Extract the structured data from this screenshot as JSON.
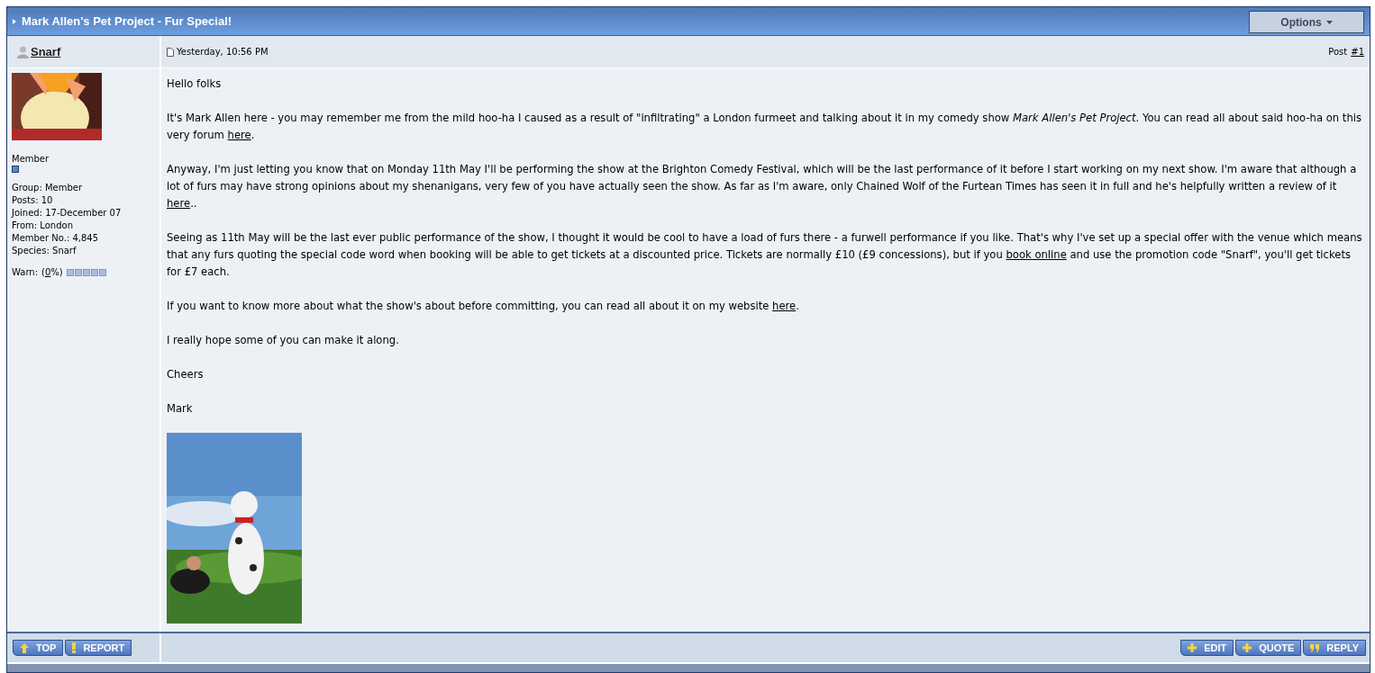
{
  "title": "Mark Allen's Pet Project - Fur Special!",
  "options_button": "Options",
  "author": {
    "name": "Snarf"
  },
  "post_meta": {
    "date": "Yesterday, 10:56 PM",
    "label": "Post",
    "number": "#1"
  },
  "sidebar": {
    "avatar": {
      "kind": "picture"
    },
    "rank": "Member",
    "details": [
      "Group: Member",
      "Posts: 10",
      "Joined: 17-December 07",
      "From: London",
      "Member No.: 4,845",
      "Species: Snarf"
    ],
    "warn": {
      "label": "Warn:",
      "open": "(",
      "link": "0",
      "close": "%)"
    }
  },
  "paragraphs": [
    [
      {
        "kind": "text",
        "text": "Hello folks"
      }
    ],
    [
      {
        "kind": "text",
        "text": "It's Mark Allen here - you may remember me from the mild hoo-ha I caused as a result of \"infiltrating\" a London furmeet and talking about it in my comedy show *Mark Allen's Pet Project*. You can read all about said hoo-ha on this very forum "
      },
      {
        "kind": "link",
        "text": "here"
      },
      {
        "kind": "text",
        "text": "."
      }
    ],
    [
      {
        "kind": "text",
        "text": "Anyway, I'm just letting you know that on Monday 11th May I'll be performing the show at the Brighton Comedy Festival, which will be the last performance of it before I start working on my next show. I'm aware that although a lot of furs may have strong opinions about my shenanigans, very few of you have actually seen the show. As far as I'm aware, only Chained Wolf of the Furtean Times has seen it in full and he's helpfully written a review of it "
      },
      {
        "kind": "link",
        "text": "here"
      },
      {
        "kind": "text",
        "text": ".."
      }
    ],
    [
      {
        "kind": "text",
        "text": "Seeing as 11th May will be the last ever public performance of the show, I thought it would be cool to have a load of furs there - a furwell performance if you like. That's why I've set up a special offer with the venue which means that any furs quoting the special code word when booking will be able to get tickets at a discounted price. Tickets are normally £10 (£9 concessions), but if you "
      },
      {
        "kind": "link",
        "text": "book online"
      },
      {
        "kind": "text",
        "text": " and use the promotion code \"Snarf\", you'll get tickets for £7 each."
      }
    ],
    [
      {
        "kind": "text",
        "text": "If you want to know more about what the show's about before committing, you can read all about it on my website "
      },
      {
        "kind": "link",
        "text": "here"
      },
      {
        "kind": "text",
        "text": "."
      }
    ],
    [
      {
        "kind": "text",
        "text": "I really hope some of you can make it along."
      }
    ],
    [
      {
        "kind": "text",
        "text": "Cheers"
      }
    ],
    [
      {
        "kind": "text",
        "text": "Mark"
      }
    ]
  ],
  "poster": {
    "kind": "picture"
  },
  "footer_left": [
    {
      "kind": "up",
      "label": "TOP"
    },
    {
      "kind": "alert",
      "label": "REPORT"
    }
  ],
  "footer_right": [
    {
      "kind": "plus",
      "label": "EDIT"
    },
    {
      "kind": "plus",
      "label": "QUOTE"
    },
    {
      "kind": "quote",
      "label": "REPLY"
    }
  ]
}
